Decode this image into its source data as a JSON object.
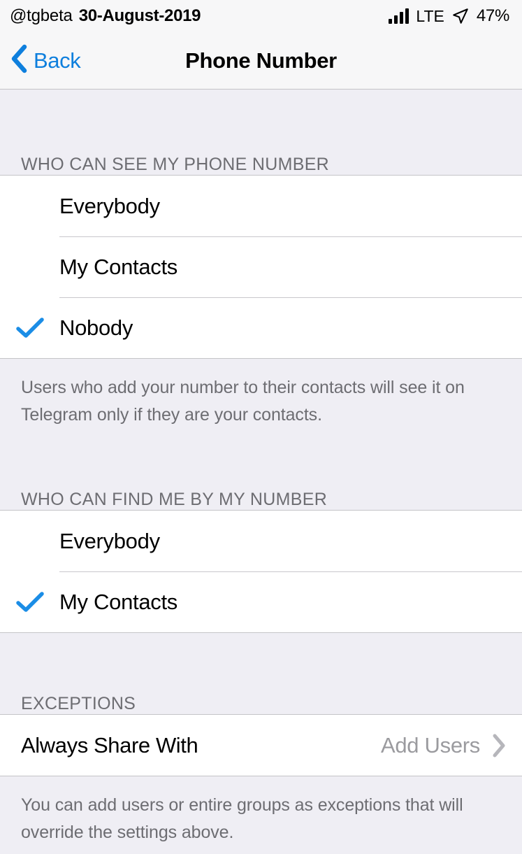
{
  "status_bar": {
    "handle": "@tgbeta",
    "date": "30-August-2019",
    "signal_icon": "signal-bars-icon",
    "network": "LTE",
    "location_icon": "location-arrow-icon",
    "battery": "47%"
  },
  "nav": {
    "back_icon": "chevron-left-icon",
    "back_label": "Back",
    "title": "Phone Number"
  },
  "sections": [
    {
      "header": "WHO CAN SEE MY PHONE NUMBER",
      "rows": [
        {
          "label": "Everybody",
          "checked": false
        },
        {
          "label": "My Contacts",
          "checked": false
        },
        {
          "label": "Nobody",
          "checked": true
        }
      ],
      "footer": "Users who add your number to their contacts will see it on Telegram only if they are your contacts."
    },
    {
      "header": "WHO CAN FIND ME BY MY NUMBER",
      "rows": [
        {
          "label": "Everybody",
          "checked": false
        },
        {
          "label": "My Contacts",
          "checked": true
        }
      ],
      "footer": ""
    },
    {
      "header": "EXCEPTIONS",
      "rows": [
        {
          "label": "Always Share With",
          "value": "Add Users",
          "disclosure_icon": "chevron-right-icon"
        }
      ],
      "footer": "You can add users or entire groups as exceptions that will override the settings above."
    }
  ],
  "colors": {
    "accent_blue": "#0e7fdd",
    "check_blue": "#1b8de6",
    "group_background": "#efeef4",
    "row_background": "#ffffff",
    "secondary_text": "#6d6d72",
    "value_text": "#9b9b9f"
  }
}
